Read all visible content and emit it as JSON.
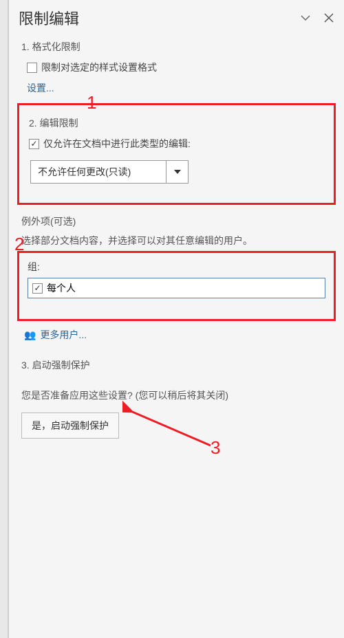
{
  "header": {
    "title": "限制编辑"
  },
  "section1": {
    "title": "1. 格式化限制",
    "checkbox_label": "限制对选定的样式设置格式",
    "settings_link": "设置..."
  },
  "section2": {
    "title": "2. 编辑限制",
    "checkbox_label": "仅允许在文档中进行此类型的编辑:",
    "dropdown_value": "不允许任何更改(只读)"
  },
  "exceptions": {
    "title": "例外项(可选)",
    "description": "选择部分文档内容，并选择可以对其任意编辑的用户。",
    "groups_label": "组:",
    "everyone_label": "每个人",
    "more_users_link": "更多用户..."
  },
  "section3": {
    "title": "3. 启动强制保护",
    "description": "您是否准备应用这些设置? (您可以稍后将其关闭)",
    "button_label": "是，启动强制保护"
  },
  "annotations": {
    "a1": "1",
    "a2": "2",
    "a3": "3"
  }
}
